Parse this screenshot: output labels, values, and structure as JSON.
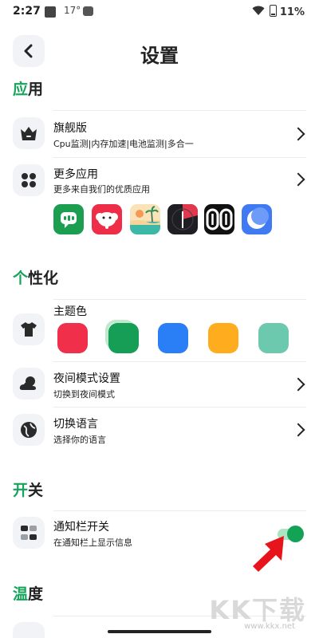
{
  "status_bar": {
    "time": "2:27",
    "temp": "17°",
    "battery": "11%"
  },
  "header": {
    "title": "设置"
  },
  "sections": {
    "apps": {
      "accent": "应",
      "rest": "用"
    },
    "personalize": {
      "accent": "个",
      "rest": "性化"
    },
    "switches": {
      "accent": "开",
      "rest": "关"
    },
    "temperature": {
      "accent": "温",
      "rest": "度"
    }
  },
  "rows": {
    "flagship": {
      "title": "旗舰版",
      "subtitle": "Cpu监测|内存加速|电池监测|多合一"
    },
    "more_apps": {
      "title": "更多应用",
      "subtitle": "更多来自我们的优质应用"
    },
    "theme": {
      "title": "主题色"
    },
    "night_mode": {
      "title": "夜间模式设置",
      "subtitle": "切换到夜间模式"
    },
    "language": {
      "title": "切换语言",
      "subtitle": "选择你的语言"
    },
    "notification": {
      "title": "通知栏开关",
      "subtitle": "在通知栏上显示信息",
      "enabled": true
    }
  },
  "theme_colors": [
    "#f0304b",
    "#169e57",
    "#2b7ff6",
    "#ffad1f",
    "#6cc9ad"
  ],
  "selected_theme_index": 1,
  "app_icons": [
    "chat-app-icon",
    "elephant-app-icon",
    "beach-app-icon",
    "clock-app-icon",
    "counter-app-icon",
    "moon-app-icon"
  ],
  "watermark": {
    "text": "KK下载",
    "url": "www.kkx.net"
  },
  "colors": {
    "accent": "#16a35a"
  }
}
